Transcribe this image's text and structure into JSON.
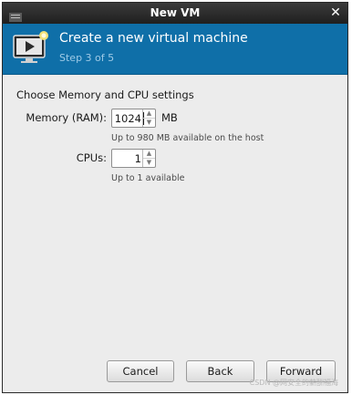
{
  "window": {
    "title": "New VM",
    "close_glyph": "✕"
  },
  "header": {
    "title": "Create a new virtual machine",
    "step": "Step 3 of 5",
    "icon": "vm-screen-icon"
  },
  "settings": {
    "heading": "Choose Memory and CPU settings",
    "memory": {
      "label": "Memory (RAM):",
      "value": "1024",
      "unit": "MB",
      "hint": "Up to 980 MB available on the host"
    },
    "cpus": {
      "label": "CPUs:",
      "value": "1",
      "hint": "Up to 1 available"
    }
  },
  "buttons": {
    "cancel": "Cancel",
    "back": "Back",
    "forward": "Forward"
  },
  "watermark": "CSDN @网安全的薪酬福海",
  "colors": {
    "header_bg": "#0f6fa8",
    "titlebar_bg": "#2c2c2c",
    "step_text": "#9ecae6"
  }
}
